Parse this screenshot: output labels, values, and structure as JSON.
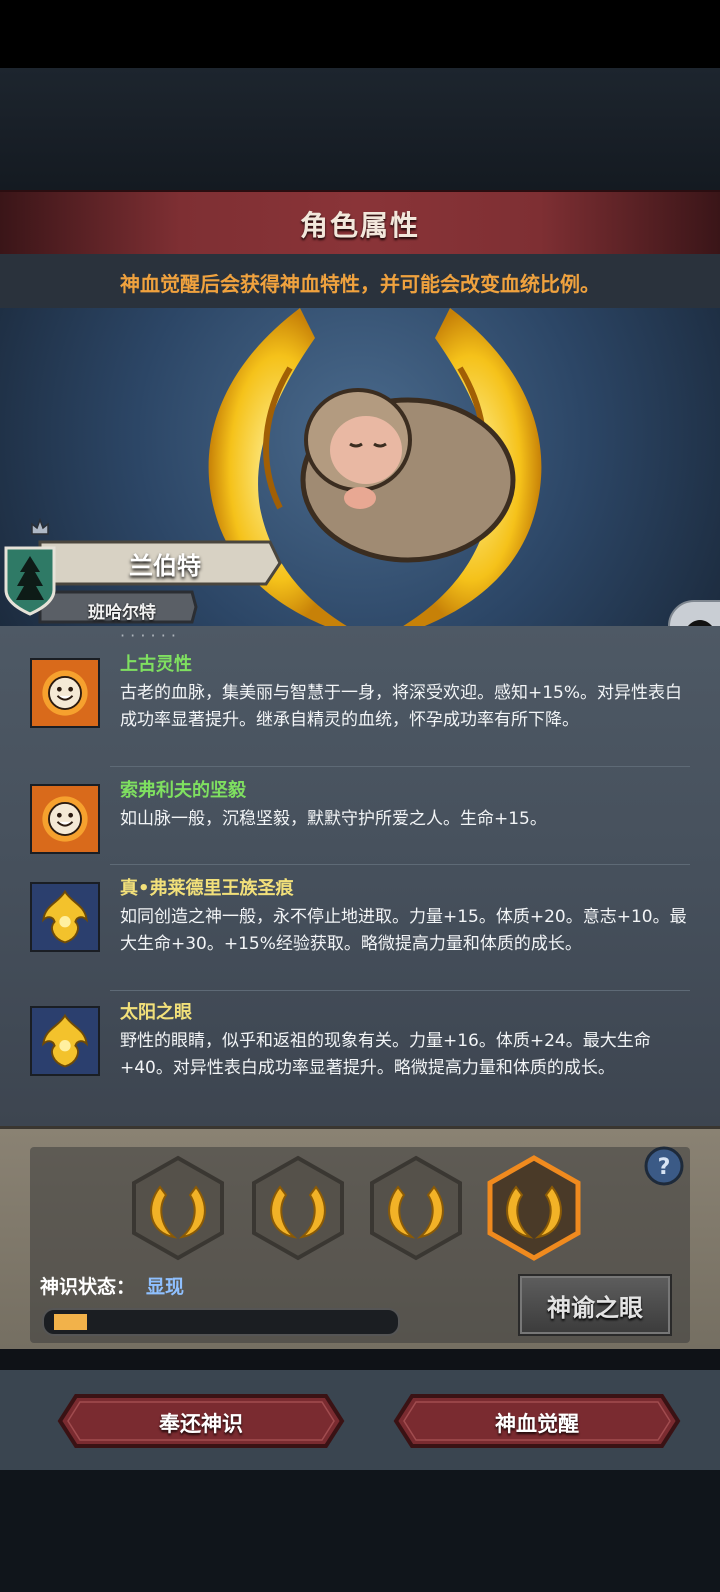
{
  "header": {
    "title": "角色属性"
  },
  "notice": "神血觉醒后会获得神血特性，并可能会改变血统比例。",
  "character": {
    "name": "兰伯特",
    "house": "班哈尔特"
  },
  "traits": [
    {
      "name": "上古灵性",
      "name_color": "#7fe060",
      "icon": "smiling-sun-icon",
      "desc": "古老的血脉，集美丽与智慧于一身，将深受欢迎。感知+15%。对异性表白成功率显著提升。继承自精灵的血统，怀孕成功率有所下降。"
    },
    {
      "name": "索弗利夫的坚毅",
      "name_color": "#7fe060",
      "icon": "smiling-sun-icon",
      "desc": "如山脉一般，沉稳坚毅，默默守护所爱之人。生命+15。"
    },
    {
      "name": "真•弗莱德里王族圣痕",
      "name_color": "#f2e07a",
      "icon": "golden-crest-icon",
      "desc": "如同创造之神一般，永不停止地进取。力量+15。体质+20。意志+10。最大生命+30。+15%经验获取。略微提高力量和体质的成长。"
    },
    {
      "name": "太阳之眼",
      "name_color": "#f2e07a",
      "icon": "golden-crest-icon",
      "desc": "野性的眼睛，似乎和返祖的现象有关。力量+16。体质+24。最大生命+40。对异性表白成功率显著提升。略微提高力量和体质的成长。"
    }
  ],
  "awakening": {
    "status_label": "神识状态：",
    "status_value": "显现",
    "progress": 0.1,
    "eye_button": "神谕之眼"
  },
  "buttons": {
    "return": "奉还神识",
    "awaken": "神血觉醒"
  },
  "colors": {
    "accent": "#f0a23e",
    "banner": "#7e2f33",
    "selected_hex": "#f08a1e"
  }
}
